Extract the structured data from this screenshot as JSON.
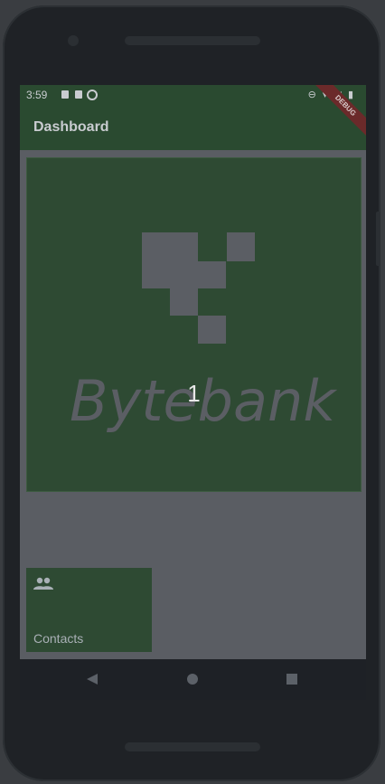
{
  "status_bar": {
    "time": "3:59",
    "right_indicators": "⊖ ▾ ◢ ▮"
  },
  "debug_banner": "DEBUG",
  "app_bar": {
    "title": "Dashboard"
  },
  "hero": {
    "logo_text": "Bytebank",
    "overlay_number": "1"
  },
  "contacts_card": {
    "icon": "people-icon",
    "label": "Contacts"
  },
  "nav_bar": {
    "back_icon": "back-triangle-icon",
    "home_icon": "home-circle-icon",
    "recents_icon": "recents-square-icon"
  },
  "colors": {
    "app_bar": "#2a4a30",
    "card": "#2e4a33",
    "screen_bg": "#5a5d63",
    "logo": "#5b5e64"
  }
}
